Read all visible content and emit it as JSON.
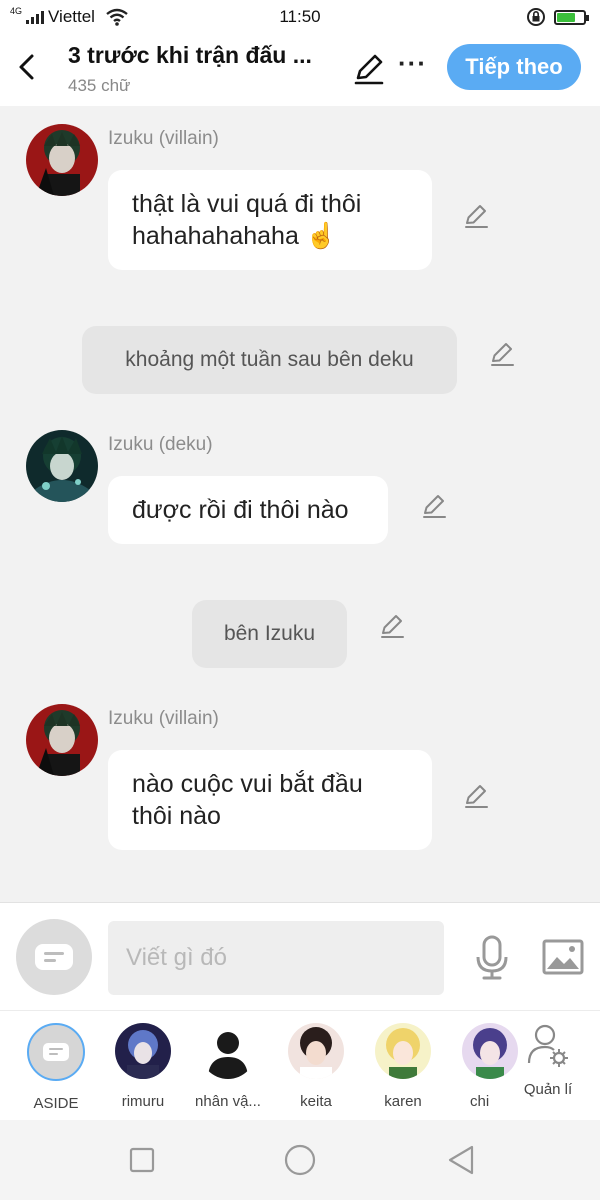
{
  "status_bar": {
    "network": "4G",
    "carrier": "Viettel",
    "time": "11:50"
  },
  "header": {
    "title": "3 trước khi trận đấu ...",
    "word_count": "435 chữ",
    "next_label": "Tiếp theo"
  },
  "messages": [
    {
      "type": "dialogue",
      "speaker": "Izuku (villain)",
      "lines": [
        "thật là vui quá đi thôi",
        "hahahahahaha ☝️"
      ]
    },
    {
      "type": "narration",
      "text": "khoảng một tuần sau bên deku"
    },
    {
      "type": "dialogue",
      "speaker": "Izuku (deku)",
      "lines": [
        "được rồi đi thôi nào"
      ]
    },
    {
      "type": "narration",
      "text": "bên Izuku"
    },
    {
      "type": "dialogue",
      "speaker": "Izuku (villain)",
      "lines": [
        "nào cuộc vui bắt đầu",
        "thôi nào"
      ]
    }
  ],
  "composer": {
    "placeholder": "Viết gì đó"
  },
  "characters": [
    {
      "name": "ASIDE"
    },
    {
      "name": "rimuru"
    },
    {
      "name": "nhân vậ..."
    },
    {
      "name": "keita"
    },
    {
      "name": "karen"
    },
    {
      "name": "chi"
    }
  ],
  "manage_label": "Quản lí",
  "colors": {
    "accent": "#5aabf3",
    "background": "#f2f2f2",
    "bubble": "#ffffff",
    "narration": "#e5e5e5",
    "speaker": "#8c8c8c"
  },
  "icons": [
    "back-arrow-icon",
    "pen-icon",
    "more-icon",
    "aside-icon",
    "microphone-icon",
    "image-icon",
    "manage-user-icon",
    "square-nav-icon",
    "circle-nav-icon",
    "triangle-nav-icon"
  ]
}
